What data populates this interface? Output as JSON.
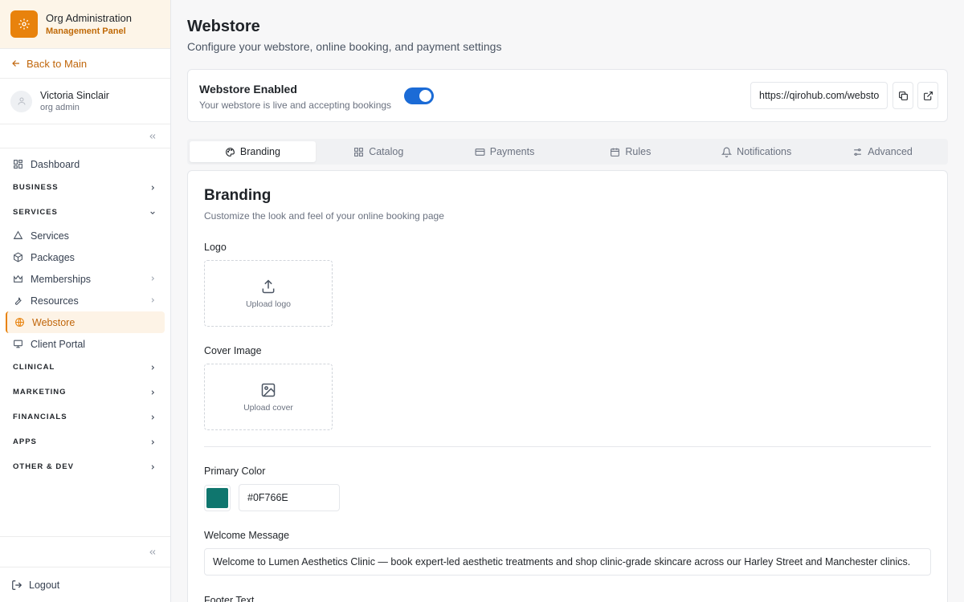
{
  "org": {
    "title": "Org Administration",
    "subtitle": "Management Panel",
    "icon": "gear-icon",
    "accent": "#E8820C"
  },
  "back": {
    "label": "Back to Main"
  },
  "user": {
    "name": "Victoria Sinclair",
    "role": "org admin"
  },
  "nav": {
    "dashboard": "Dashboard",
    "business": "BUSINESS",
    "services_section": "SERVICES",
    "services": "Services",
    "packages": "Packages",
    "memberships": "Memberships",
    "resources": "Resources",
    "webstore": "Webstore",
    "client_portal": "Client Portal",
    "clinical": "CLINICAL",
    "marketing": "MARKETING",
    "financials": "FINANCIALS",
    "apps": "APPS",
    "other_dev": "OTHER & DEV",
    "logout": "Logout"
  },
  "page": {
    "title": "Webstore",
    "subtitle": "Configure your webstore, online booking, and payment settings"
  },
  "webstore": {
    "enabled_title": "Webstore Enabled",
    "enabled_sub": "Your webstore is live and accepting bookings",
    "enabled": true,
    "url": "https://qirohub.com/webstore"
  },
  "tabs": [
    "Branding",
    "Catalog",
    "Payments",
    "Rules",
    "Notifications",
    "Advanced"
  ],
  "branding": {
    "title": "Branding",
    "subtitle": "Customize the look and feel of your online booking page",
    "logo_label": "Logo",
    "upload_logo": "Upload logo",
    "cover_label": "Cover Image",
    "upload_cover": "Upload cover",
    "primary_color_label": "Primary Color",
    "primary_color": "#0F766E",
    "welcome_label": "Welcome Message",
    "welcome_message": "Welcome to Lumen Aesthetics Clinic — book expert-led aesthetic treatments and shop clinic-grade skincare across our Harley Street and Manchester clinics.",
    "footer_label": "Footer Text"
  }
}
